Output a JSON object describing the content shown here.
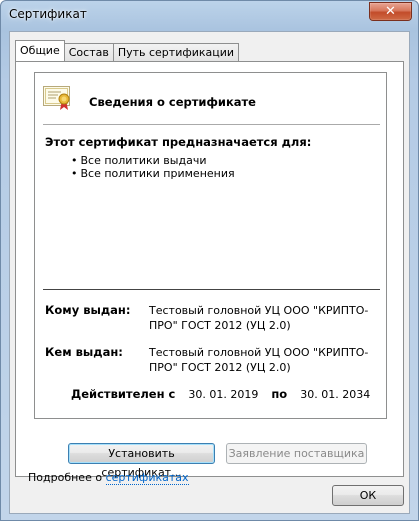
{
  "window": {
    "title": "Сертификат",
    "close_glyph": "✕"
  },
  "tabs": [
    {
      "label": "Общие",
      "active": true
    },
    {
      "label": "Состав",
      "active": false
    },
    {
      "label": "Путь сертификации",
      "active": false
    }
  ],
  "certificate": {
    "icon": "certificate-icon",
    "header_title": "Сведения о сертификате",
    "purpose_title": "Этот сертификат предназначается для:",
    "purposes": [
      "Все политики выдачи",
      "Все политики применения"
    ],
    "issued_to_label": "Кому выдан:",
    "issued_to_value": "Тестовый головной УЦ ООО \"КРИПТО-ПРО\" ГОСТ 2012 (УЦ 2.0)",
    "issued_by_label": "Кем выдан:",
    "issued_by_value": "Тестовый головной УЦ ООО \"КРИПТО-ПРО\" ГОСТ 2012 (УЦ 2.0)",
    "valid_from_label": "Действителен с",
    "valid_from": "30. 01. 2019",
    "valid_to_label": "по",
    "valid_to": "30. 01. 2034"
  },
  "buttons": {
    "install": "Установить сертификат...",
    "issuer_statement": "Заявление поставщика",
    "ok": "ОК"
  },
  "footer": {
    "prefix": "Подробнее о ",
    "link": "сертификатах"
  },
  "colors": {
    "link": "#0066cc",
    "close": "#c24c2a",
    "focus": "#3c7fb1"
  }
}
